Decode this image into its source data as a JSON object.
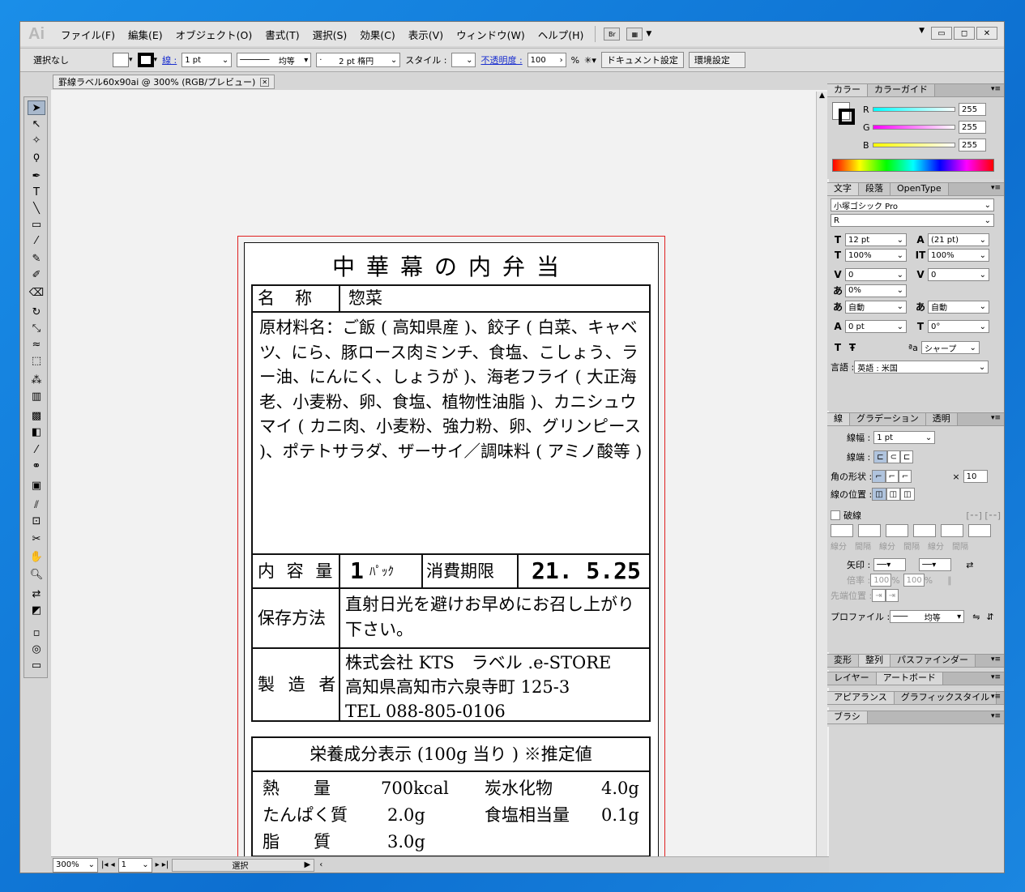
{
  "app": {
    "logo": "Ai"
  },
  "menu": [
    "ファイル(F)",
    "編集(E)",
    "オブジェクト(O)",
    "書式(T)",
    "選択(S)",
    "効果(C)",
    "表示(V)",
    "ウィンドウ(W)",
    "ヘルプ(H)"
  ],
  "menu_extra": {
    "br": "Br"
  },
  "control": {
    "selection": "選択なし",
    "stroke_label": "線 :",
    "stroke_value": "1 pt",
    "profile": "均等",
    "brush": "2 pt 楕円",
    "style_label": "スタイル :",
    "opacity_label": "不透明度 :",
    "opacity_value": "100",
    "opacity_unit": "%",
    "doc_setup": "ドキュメント設定",
    "prefs": "環境設定"
  },
  "document": {
    "tab_title": "罫線ラベル60x90ai @ 300% (RGB/プレビュー)"
  },
  "label": {
    "title": "中華幕の内弁当",
    "name_key": "名　称",
    "name_value": "惣菜",
    "ingredients": "原材料名：ご飯 ( 高知県産 )、餃子 ( 白菜、キャベツ、にら、豚ロース肉ミンチ、食塩、こしょう、ラー油、にんにく、しょうが )、海老フライ ( 大正海老、小麦粉、卵、食塩、植物性油脂 )、カニシュウマイ ( カニ肉、小麦粉、強力粉、卵、グリンピース )、ポテトサラダ、ザーサイ／調味料 ( アミノ酸等 )",
    "content_key": "内 容 量",
    "content_num": "1",
    "content_unit": "ﾊﾟｯｸ",
    "expiry_key": "消費期限",
    "expiry_value": "21. 5.25",
    "storage_key": "保存方法",
    "storage_value": "直射日光を避けお早めにお召し上がり下さい。",
    "maker_key": "製 造 者",
    "maker_lines": [
      "株式会社 KTS　ラベル .e-STORE",
      "高知県高知市六泉寺町 125-3",
      "TEL 088-805-0106"
    ]
  },
  "nutrition": {
    "header": "栄養成分表示 (100g 当り ) ※推定値",
    "rows": [
      {
        "k1": "熱　　量",
        "v1": "700kcal",
        "k2": "炭水化物",
        "v2": "4.0g"
      },
      {
        "k1": "たんぱく質",
        "v1": "2.0g",
        "k2": "食塩相当量",
        "v2": "0.1g"
      },
      {
        "k1": "脂　　質",
        "v1": "3.0g",
        "k2": "",
        "v2": ""
      }
    ]
  },
  "status": {
    "zoom": "300%",
    "page": "1",
    "mode": "選択"
  },
  "panels": {
    "color_tabs": [
      "カラー",
      "カラーガイド"
    ],
    "rgb": [
      {
        "ch": "R",
        "v": "255"
      },
      {
        "ch": "G",
        "v": "255"
      },
      {
        "ch": "B",
        "v": "255"
      }
    ],
    "char_tabs": [
      "文字",
      "段落",
      "OpenType"
    ],
    "font": "小塚ゴシック Pro",
    "font_style": "R",
    "size": "12 pt",
    "leading": "(21 pt)",
    "vscale": "100%",
    "hscale": "100%",
    "kern": "0",
    "track": "0",
    "tsume": "0%",
    "aki1": "自動",
    "aki2": "自動",
    "baseline": "0 pt",
    "rotate": "0°",
    "aa": "シャープ",
    "lang_label": "言語 :",
    "lang": "英語 : 米国",
    "stroke_tabs": [
      "線",
      "グラデーション",
      "透明"
    ],
    "weight_label": "線幅 :",
    "weight": "1 pt",
    "cap_label": "線端 :",
    "corner_label": "角の形状 :",
    "limit": "10",
    "align_label": "線の位置 :",
    "dash_label": "破線",
    "dash_cells": [
      "線分",
      "間隔",
      "線分",
      "間隔",
      "線分",
      "間隔"
    ],
    "arrow_label": "矢印 :",
    "scale_label": "倍率 :",
    "scale1": "100",
    "scale2": "100",
    "tip_label": "先端位置 :",
    "profile_label": "プロファイル :",
    "profile": "均等",
    "t_tabs": [
      "変形",
      "整列",
      "パスファインダー"
    ],
    "layer_tabs": [
      "レイヤー",
      "アートボード"
    ],
    "app_tabs": [
      "アピアランス",
      "グラフィックスタイル"
    ],
    "brush_tabs": [
      "ブラシ"
    ]
  }
}
